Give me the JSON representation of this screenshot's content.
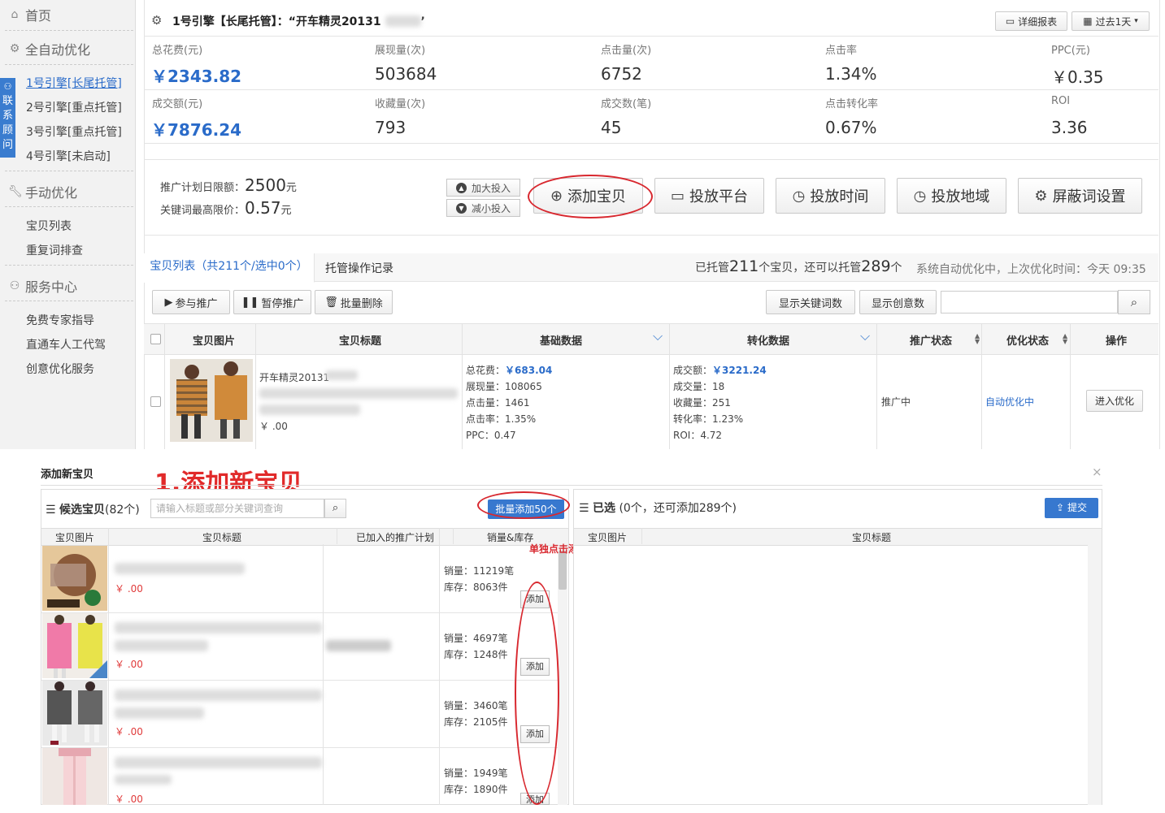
{
  "sidebar": {
    "home": "首页",
    "auto_opt": "全自动优化",
    "contact": [
      "联",
      "系",
      "顾",
      "问"
    ],
    "engines": [
      "1号引擎[长尾托管]",
      "2号引擎[重点托管]",
      "3号引擎[重点托管]",
      "4号引擎[未启动]"
    ],
    "manual_opt": "手动优化",
    "manual_items": [
      "宝贝列表",
      "重复词排查"
    ],
    "service": "服务中心",
    "service_items": [
      "免费专家指导",
      "直通车人工代驾",
      "创意优化服务"
    ]
  },
  "header": {
    "title": "1号引擎【长尾托管】：“开车精灵20131",
    "detail_report": "详细报表",
    "date_range": "过去1天"
  },
  "stats": [
    {
      "label": "总花费(元)",
      "value": "￥2343.82"
    },
    {
      "label": "展现量(次)",
      "value": "503684"
    },
    {
      "label": "点击量(次)",
      "value": "6752"
    },
    {
      "label": "点击率",
      "value": "1.34%"
    },
    {
      "label": "PPC(元)",
      "value": "￥0.35"
    },
    {
      "label": "成交额(元)",
      "value": "￥7876.24"
    },
    {
      "label": "收藏量(次)",
      "value": "793"
    },
    {
      "label": "成交数(笔)",
      "value": "45"
    },
    {
      "label": "点击转化率",
      "value": "0.67%"
    },
    {
      "label": "ROI",
      "value": "3.36"
    }
  ],
  "budget": {
    "daily_label": "推广计划日限额：",
    "daily_value": "2500",
    "max_bid_label": "关键词最高限价：",
    "max_bid_value": "0.57",
    "unit": "元",
    "increase": "加大投入",
    "decrease": "减小投入"
  },
  "actions": [
    "添加宝贝",
    "投放平台",
    "投放时间",
    "投放地域",
    "屏蔽词设置"
  ],
  "tabs": {
    "items": "宝贝列表（共211个/选中0个）",
    "log": "托管操作记录"
  },
  "managed": {
    "prefix": "已托管",
    "count": "211",
    "mid": "个宝贝，还可以托管",
    "remain": "289",
    "suffix": "个",
    "sys": "系统自动优化中，上次优化时间：今天 09:35"
  },
  "toolbar": {
    "join": "参与推广",
    "pause": "暂停推广",
    "delete": "批量删除",
    "show_kw": "显示关键词数",
    "show_creative": "显示创意数"
  },
  "table": {
    "headers": [
      "宝贝图片",
      "宝贝标题",
      "基础数据",
      "转化数据",
      "推广状态",
      "优化状态",
      "操作"
    ],
    "row": {
      "title": "开车精灵20131",
      "price": "￥    .00",
      "basic": [
        {
          "k": "总花费：",
          "v": "￥683.04"
        },
        {
          "k": "展现量：",
          "v": "108065"
        },
        {
          "k": "点击量：",
          "v": "1461"
        },
        {
          "k": "点击率：",
          "v": "1.35%"
        },
        {
          "k": "PPC：",
          "v": "0.47"
        }
      ],
      "conv": [
        {
          "k": "成交额：",
          "v": "￥3221.24"
        },
        {
          "k": "成交量：",
          "v": "18"
        },
        {
          "k": "收藏量：",
          "v": "251"
        },
        {
          "k": "转化率：",
          "v": "1.23%"
        },
        {
          "k": "ROI：",
          "v": "4.72"
        }
      ],
      "promo_status": "推广中",
      "opt_status": "自动优化中",
      "action": "进入优化"
    }
  },
  "dialog": {
    "title": "添加新宝贝",
    "step": "1.添加新宝贝",
    "close": "×",
    "candidates_label": "候选宝贝",
    "candidates_count": "(82个)",
    "search_placeholder": "请输入标题或部分关键词查询",
    "batch_add": "批量添加50个",
    "selected_label": "已选",
    "selected_text": "(0个，还可添加289个)",
    "submit": "提交",
    "annotation": "单独点击添加，或批量添加",
    "left_headers": [
      "宝贝图片",
      "宝贝标题",
      "已加入的推广计划",
      "销量&库存"
    ],
    "right_headers": [
      "宝贝图片",
      "宝贝标题"
    ],
    "rows": [
      {
        "price": "￥  .00",
        "sales": "销量：11219笔",
        "stock": "库存：8063件",
        "add": "添加"
      },
      {
        "price": "￥   .00",
        "sales": "销量：4697笔",
        "stock": "库存：1248件",
        "add": "添加"
      },
      {
        "price": "￥   .00",
        "sales": "销量：3460笔",
        "stock": "库存：2105件",
        "add": "添加"
      },
      {
        "price": "￥   .00",
        "sales": "销量：1949笔",
        "stock": "库存：1890件",
        "add": "添加"
      }
    ]
  },
  "colors": {
    "accent": "#2a6bc9",
    "button_blue": "#3778cf",
    "annotation_red": "#d8282f"
  }
}
